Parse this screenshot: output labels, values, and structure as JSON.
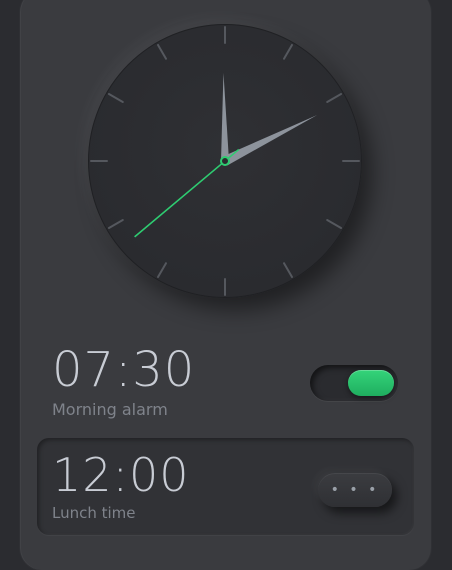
{
  "clock": {
    "hour": 2,
    "minute": 0,
    "second": 38,
    "accent_color": "#2ecc71",
    "hand_color": "#8d939c"
  },
  "alarms": [
    {
      "time": "07:30",
      "label": "Morning alarm",
      "enabled": true
    },
    {
      "time": "12:00",
      "label": "Lunch time",
      "more_label": "• • •"
    }
  ]
}
